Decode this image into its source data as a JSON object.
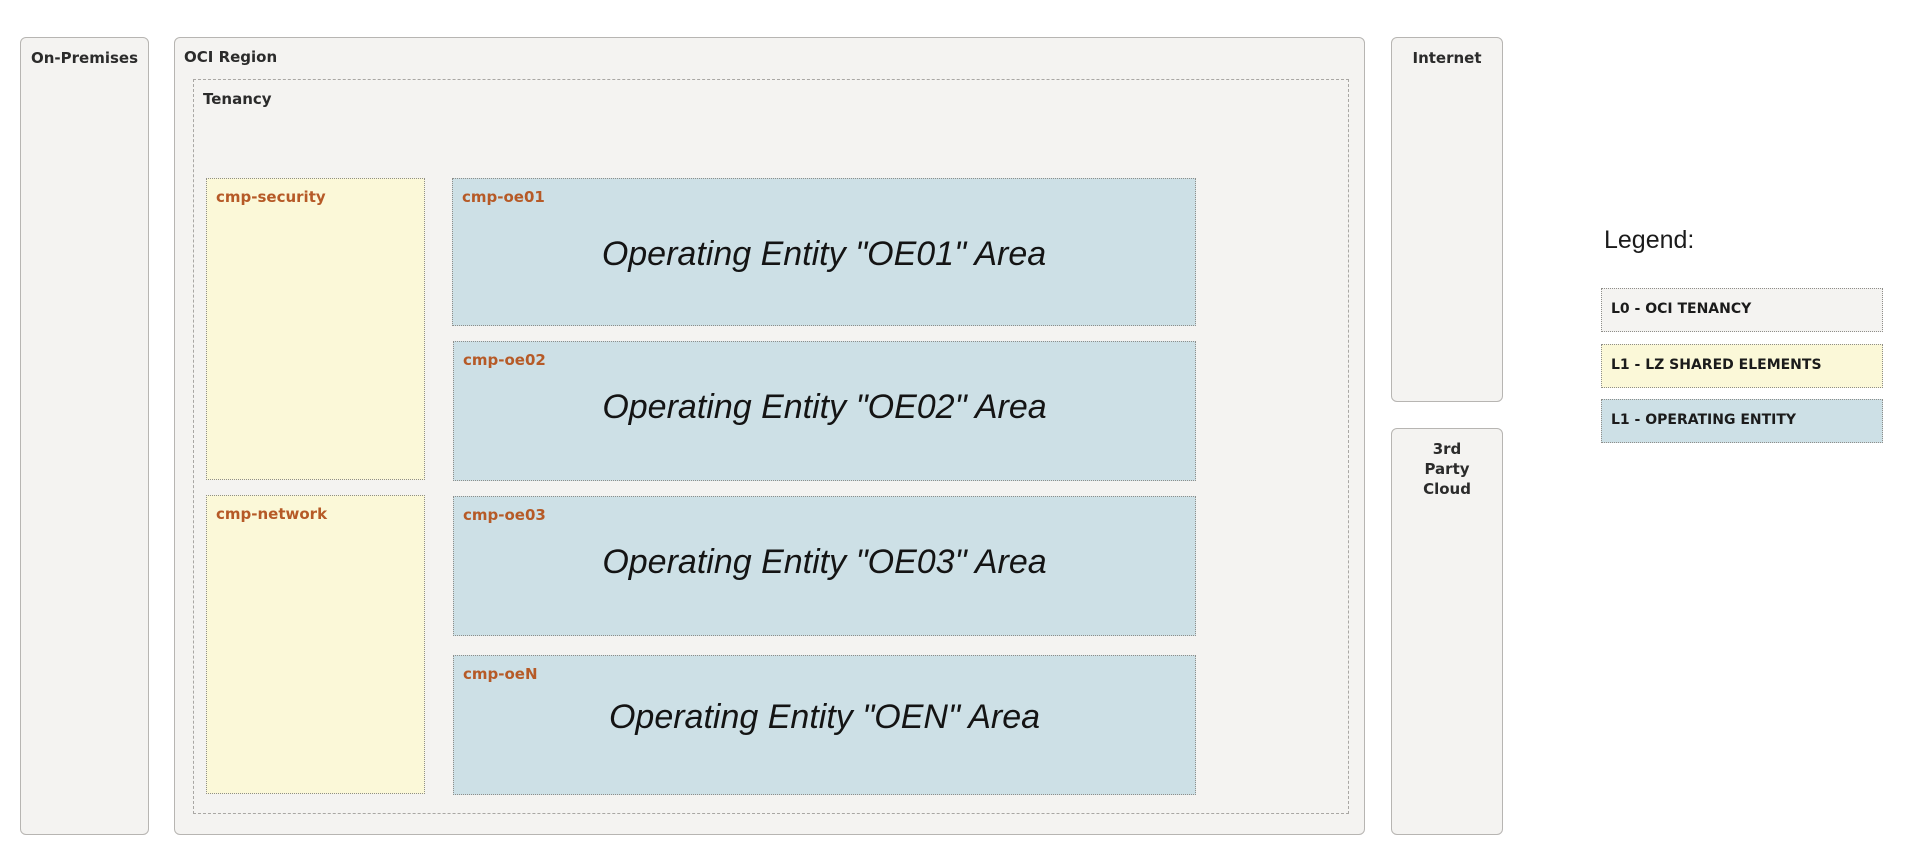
{
  "regions": {
    "on_premises": "On-Premises",
    "oci_region": "OCI Region",
    "tenancy": "Tenancy",
    "internet": "Internet",
    "third_party_cloud": "3rd Party Cloud"
  },
  "compartments": {
    "security": "cmp-security",
    "network": "cmp-network",
    "oe": [
      {
        "label": "cmp-oe01",
        "area": "Operating Entity \"OE01\" Area"
      },
      {
        "label": "cmp-oe02",
        "area": "Operating Entity \"OE02\" Area"
      },
      {
        "label": "cmp-oe03",
        "area": "Operating Entity \"OE03\" Area"
      },
      {
        "label": "cmp-oeN",
        "area": "Operating Entity \"OEN\" Area"
      }
    ]
  },
  "legend": {
    "title": "Legend:",
    "items": [
      {
        "label": "L0 - OCI TENANCY",
        "color": "#f4f3f1"
      },
      {
        "label": "L1 - LZ SHARED ELEMENTS",
        "color": "#fbf8d8"
      },
      {
        "label": "L1 - OPERATING ENTITY",
        "color": "#cde0e6"
      }
    ]
  },
  "colors": {
    "panel_background": "#f4f3f1",
    "shared_background": "#fbf8d8",
    "operating_entity_background": "#cde0e6",
    "compartment_label": "#b65a27"
  }
}
